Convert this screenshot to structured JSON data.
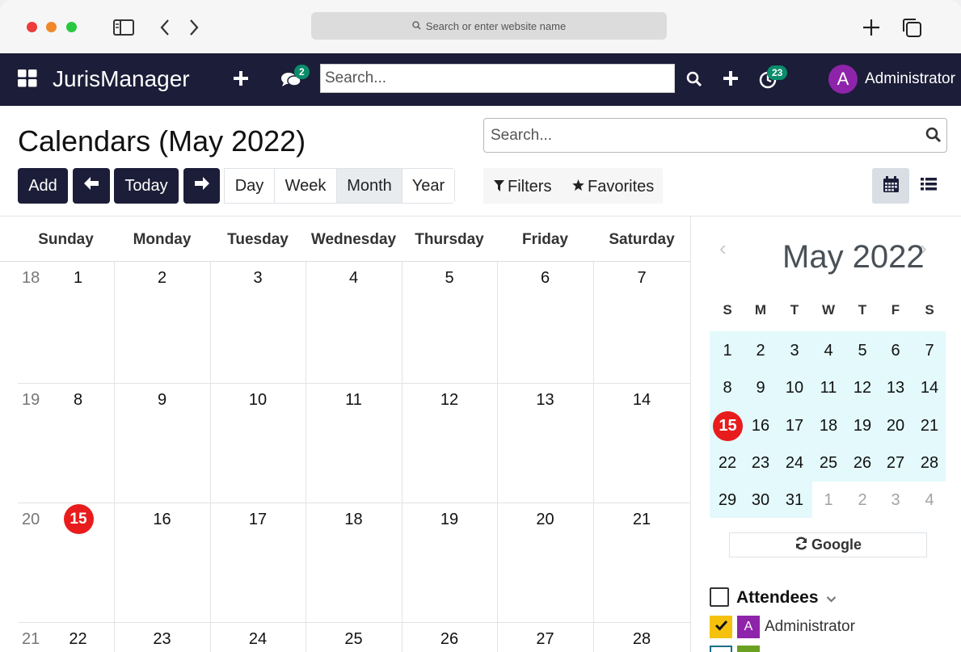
{
  "browser": {
    "url_placeholder": "Search or enter website name"
  },
  "navbar": {
    "app_name": "JurisManager",
    "messages_badge": "2",
    "search_placeholder": "Search...",
    "activity_badge": "23",
    "user_initial": "A",
    "user_name": "Administrator"
  },
  "control_panel": {
    "title": "Calendars (May 2022)",
    "search_placeholder": "Search...",
    "add_label": "Add",
    "today_label": "Today",
    "scales": [
      "Day",
      "Week",
      "Month",
      "Year"
    ],
    "active_scale": "Month",
    "filters_label": "Filters",
    "favorites_label": "Favorites",
    "active_view": "calendar"
  },
  "month_grid": {
    "weekdays": [
      "Sunday",
      "Monday",
      "Tuesday",
      "Wednesday",
      "Thursday",
      "Friday",
      "Saturday"
    ],
    "weeks": [
      {
        "week": "18",
        "days": [
          "1",
          "2",
          "3",
          "4",
          "5",
          "6",
          "7"
        ]
      },
      {
        "week": "19",
        "days": [
          "8",
          "9",
          "10",
          "11",
          "12",
          "13",
          "14"
        ]
      },
      {
        "week": "20",
        "days": [
          "15",
          "16",
          "17",
          "18",
          "19",
          "20",
          "21"
        ]
      },
      {
        "week": "21",
        "days": [
          "22",
          "23",
          "24",
          "25",
          "26",
          "27",
          "28"
        ]
      }
    ],
    "today": "15"
  },
  "sidebar": {
    "mini_title": "May 2022",
    "weekday_initials": [
      "S",
      "M",
      "T",
      "W",
      "T",
      "F",
      "S"
    ],
    "weeks": [
      [
        "1",
        "2",
        "3",
        "4",
        "5",
        "6",
        "7"
      ],
      [
        "8",
        "9",
        "10",
        "11",
        "12",
        "13",
        "14"
      ],
      [
        "15",
        "16",
        "17",
        "18",
        "19",
        "20",
        "21"
      ],
      [
        "22",
        "23",
        "24",
        "25",
        "26",
        "27",
        "28"
      ],
      [
        "29",
        "30",
        "31",
        "1",
        "2",
        "3",
        "4"
      ]
    ],
    "today": "15",
    "google_label": "Google",
    "attendees_label": "Attendees",
    "attendee": {
      "initial": "A",
      "name": "Administrator"
    }
  },
  "colors": {
    "navbar": "#1c1d38",
    "today": "#e81c1c",
    "badge": "#0b8c6b",
    "avatar": "#8e24aa",
    "mini_highlight": "#e3f9fb",
    "attendee_check": "#f4c20d"
  }
}
